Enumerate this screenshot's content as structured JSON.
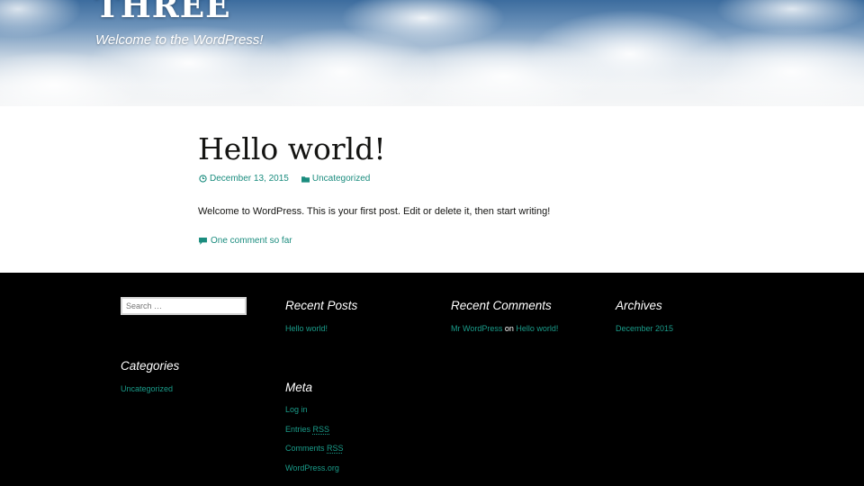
{
  "header": {
    "site_title": "THREE",
    "site_description": "Welcome to the WordPress!"
  },
  "post": {
    "title": "Hello world!",
    "date": "December 13, 2015",
    "category": "Uncategorized",
    "body": "Welcome to WordPress. This is your first post. Edit or delete it, then start writing!",
    "comments_link": "One comment so far",
    "date_icon": "clock-icon",
    "category_icon": "folder-icon",
    "comments_icon": "comment-bubble-icon"
  },
  "footer": {
    "search_placeholder": "Search …",
    "recent_posts": {
      "title": "Recent Posts",
      "items": [
        "Hello world!"
      ]
    },
    "recent_comments": {
      "title": "Recent Comments",
      "author": "Mr WordPress",
      "connector": "on",
      "post": "Hello world!"
    },
    "archives": {
      "title": "Archives",
      "items": [
        "December 2015"
      ]
    },
    "categories": {
      "title": "Categories",
      "items": [
        "Uncategorized"
      ]
    },
    "meta": {
      "title": "Meta",
      "log_in": "Log in",
      "entries_prefix": "Entries",
      "comments_prefix": "Comments",
      "rss": "RSS",
      "wordpress_org": "WordPress.org"
    }
  },
  "colors": {
    "link": "#1a8c7e",
    "footer_background": "#000000",
    "content_background": "#ffffff"
  }
}
